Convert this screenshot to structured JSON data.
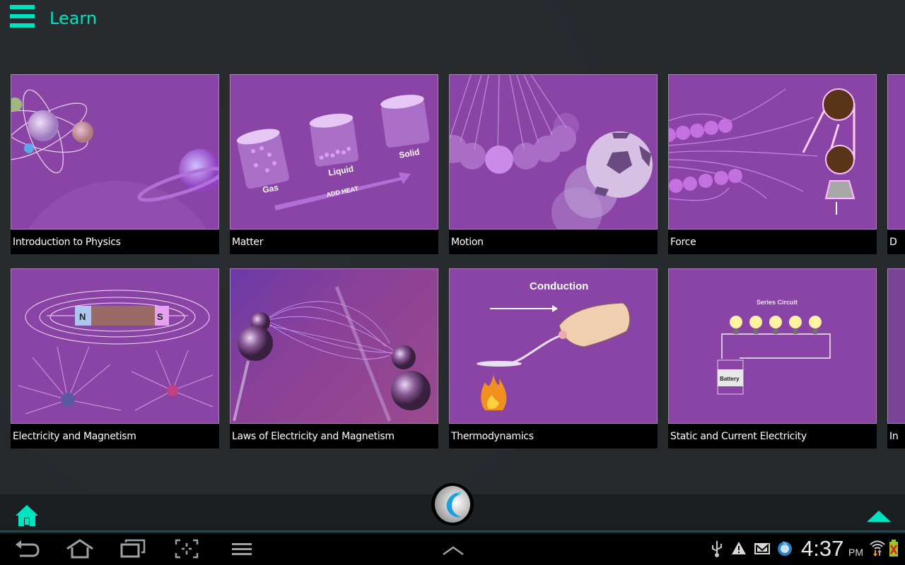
{
  "header": {
    "title": "Learn",
    "menu_icon": "hamburger-menu-icon"
  },
  "colors": {
    "accent": "#00e3c0",
    "card_purple": "#8a44a6",
    "background": "#262a2d",
    "app_bar": "#1c1f22"
  },
  "cards": [
    {
      "label": "Introduction to Physics"
    },
    {
      "label": "Matter",
      "illustration": {
        "labels": [
          "Gas",
          "Liquid",
          "Solid"
        ],
        "arrow_text": "ADD HEAT"
      }
    },
    {
      "label": "Motion"
    },
    {
      "label": "Force"
    },
    {
      "label": "D"
    },
    {
      "label": "Electricity and Magnetism",
      "illustration": {
        "north": "N",
        "south": "S"
      }
    },
    {
      "label": "Laws of Electricity and Magnetism"
    },
    {
      "label": "Thermodynamics",
      "illustration": {
        "title": "Conduction"
      }
    },
    {
      "label": "Static and Current Electricity",
      "illustration": {
        "title": "Series Circuit",
        "battery": "Battery"
      }
    },
    {
      "label": "In"
    }
  ],
  "app_bar": {
    "home_icon": "home-icon",
    "logo_icon": "app-logo-icon",
    "up_icon": "triangle-up-icon"
  },
  "system_bar": {
    "buttons": [
      "back-icon",
      "home-outline-icon",
      "recent-apps-icon",
      "screenshot-icon",
      "menu-icon"
    ],
    "expand_icon": "chevron-up-icon",
    "status_icons": [
      "usb-icon",
      "warning-icon",
      "gmail-icon",
      "sync-app-icon",
      "wifi-icon",
      "battery-icon"
    ],
    "time": "4:37",
    "ampm": "PM"
  }
}
